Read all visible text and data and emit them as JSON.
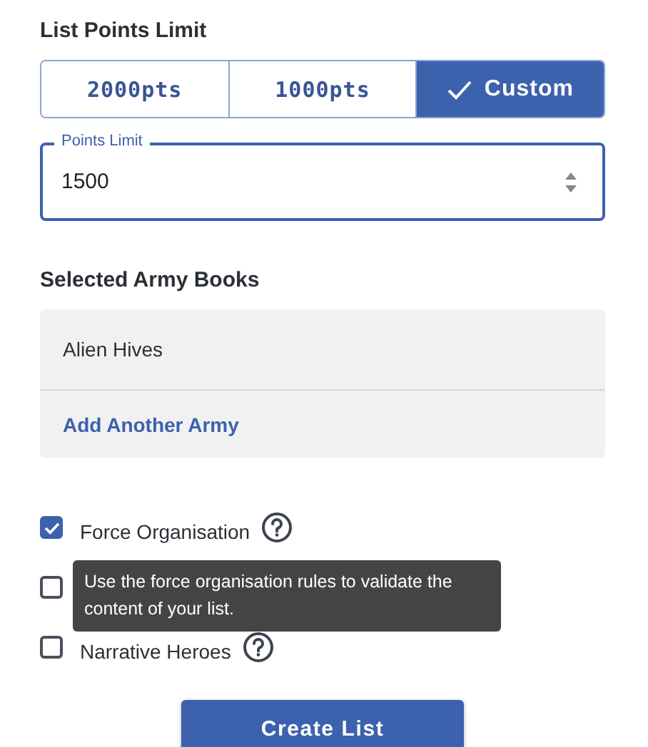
{
  "points_heading": "List Points Limit",
  "points_options": [
    {
      "label": "2000pts",
      "selected": false
    },
    {
      "label": "1000pts",
      "selected": false
    },
    {
      "label": "Custom",
      "selected": true
    }
  ],
  "points_field": {
    "label": "Points Limit",
    "value": "1500"
  },
  "army_heading": "Selected Army Books",
  "army_books": [
    "Alien Hives"
  ],
  "add_army": "Add Another Army",
  "options": [
    {
      "label": "Force Organisation",
      "checked": true
    },
    {
      "checked": false
    },
    {
      "label": "Narrative Heroes",
      "checked": false
    }
  ],
  "tooltip": "Use the force organisation rules to validate the content of your list.",
  "create_button": "Create List"
}
